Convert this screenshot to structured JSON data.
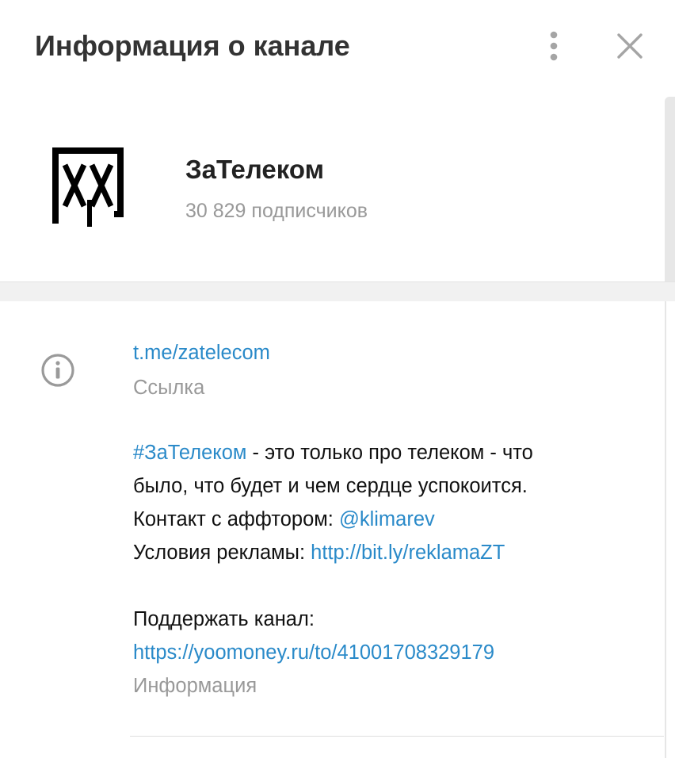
{
  "header": {
    "title": "Информация о канале",
    "more_icon": "vertical-dots-icon",
    "close_icon": "close-icon"
  },
  "channel": {
    "avatar_icon": "zatelecom-logo",
    "name": "ЗаТелеком",
    "subscribers": "30 829 подписчиков"
  },
  "info": {
    "icon": "info-icon",
    "link": {
      "value": "t.me/zatelecom",
      "caption": "Ссылка"
    },
    "description": {
      "hashtag": "#ЗаТелеком",
      "line1_rest": " - это только про телеком - что",
      "line2": "было, что будет и чем сердце успокоится.",
      "line3_prefix": "Контакт с аффтором: ",
      "contact": "@klimarev",
      "line4_prefix": "Условия рекламы: ",
      "ads_link": "http://bit.ly/reklamaZT",
      "support_label": "Поддержать канал:",
      "support_link": "https://yoomoney.ru/to/41001708329179",
      "caption": "Информация"
    }
  },
  "colors": {
    "link": "#2a8ac9",
    "caption": "#999999",
    "title": "#333333",
    "text": "#111111"
  }
}
